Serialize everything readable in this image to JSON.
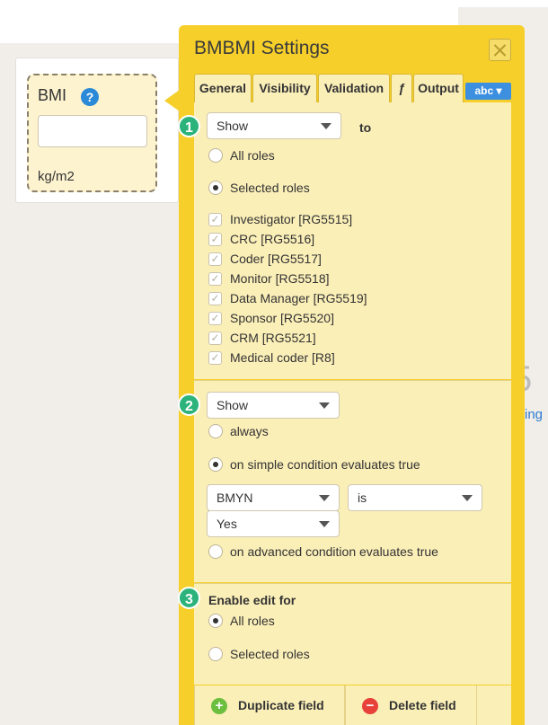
{
  "field": {
    "label": "BMI",
    "help_glyph": "?",
    "unit": "kg/m2"
  },
  "background": {
    "partial_glyph": "5",
    "partial_link": "ing"
  },
  "panel": {
    "title": "BMBMI Settings",
    "tabs": [
      "General",
      "Visibility",
      "Validation",
      "ƒ",
      "Output"
    ],
    "type_badge": "abc ▾"
  },
  "visibility": {
    "step": "1",
    "action": "Show",
    "to_label": "to",
    "options": [
      "All roles",
      "Selected roles"
    ],
    "selected_option": "Selected roles",
    "roles": [
      "Investigator [RG5515]",
      "CRC [RG5516]",
      "Coder [RG5517]",
      "Monitor [RG5518]",
      "Data Manager [RG5519]",
      "Sponsor [RG5520]",
      "CRM [RG5521]",
      "Medical coder [R8]"
    ]
  },
  "condition": {
    "step": "2",
    "action": "Show",
    "options": [
      "always",
      "on simple condition evaluates true",
      "on advanced condition evaluates true"
    ],
    "selected_option": "on simple condition evaluates true",
    "field_select": "BMYN",
    "operator_select": "is",
    "value_select": "Yes"
  },
  "edit": {
    "step": "3",
    "heading": "Enable edit for",
    "options": [
      "All roles",
      "Selected roles"
    ],
    "selected_option": "All roles"
  },
  "footer": {
    "duplicate": "Duplicate field",
    "delete": "Delete field"
  },
  "colors": {
    "panel": "#f6cf2b",
    "section": "#fbefb8",
    "step_badge": "#2cb37c",
    "accent": "#3d8fe0",
    "delete": "#e8413a",
    "add": "#6cbe3f"
  }
}
